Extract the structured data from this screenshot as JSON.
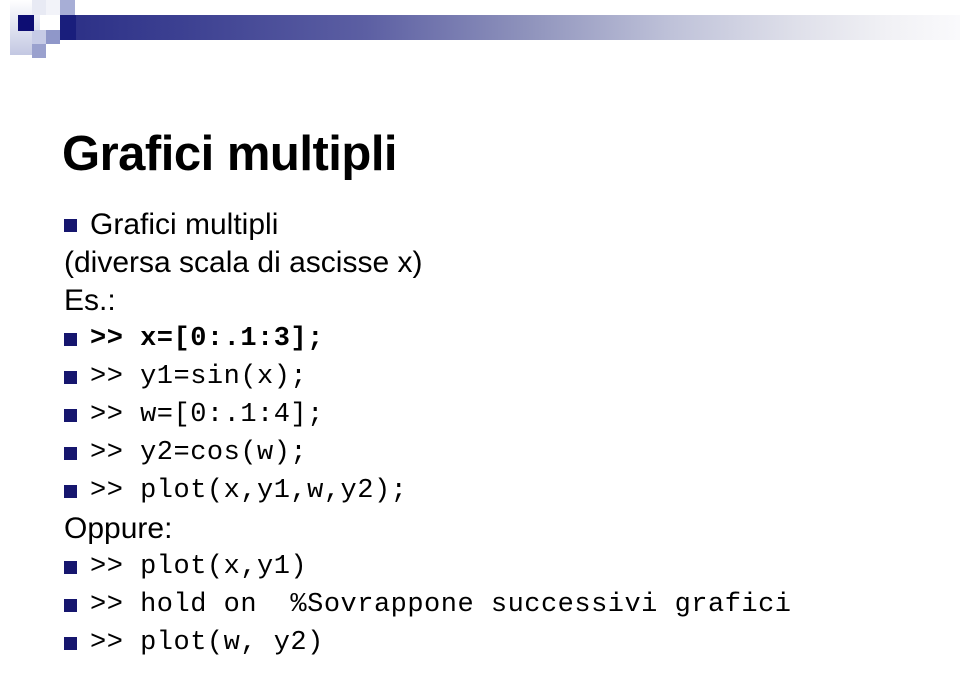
{
  "slide": {
    "title": "Grafici multipli",
    "theme": {
      "bullet_color": "#16166e",
      "accent_dark": "#191e7c",
      "accent_mid": "#8f93bc",
      "accent_light": "#c6cbe6",
      "text_color": "#000000",
      "background": "#ffffff"
    },
    "header": {
      "decoration_name": "checkered-squares-and-gradient-bar"
    },
    "body": {
      "lines": [
        {
          "bullet": true,
          "style": "sans",
          "bold": false,
          "text": "Grafici multipli"
        },
        {
          "bullet": false,
          "style": "sans",
          "bold": false,
          "text": "(diversa scala di ascisse x)"
        },
        {
          "bullet": false,
          "style": "sans",
          "bold": false,
          "text": "Es.:"
        },
        {
          "bullet": true,
          "style": "mono",
          "bold": true,
          "text": ">> x=[0:.1:3];"
        },
        {
          "bullet": true,
          "style": "mono",
          "bold": false,
          "text": ">> y1=sin(x);"
        },
        {
          "bullet": true,
          "style": "mono",
          "bold": false,
          "text": ">> w=[0:.1:4];"
        },
        {
          "bullet": true,
          "style": "mono",
          "bold": false,
          "text": ">> y2=cos(w);"
        },
        {
          "bullet": true,
          "style": "mono",
          "bold": false,
          "text": ">> plot(x,y1,w,y2);"
        },
        {
          "bullet": false,
          "style": "sans",
          "bold": false,
          "text": "Oppure:"
        },
        {
          "bullet": true,
          "style": "mono",
          "bold": false,
          "text": ">> plot(x,y1)"
        },
        {
          "bullet": true,
          "style": "mono",
          "bold": false,
          "text": ">> hold on  %Sovrappone successivi grafici"
        },
        {
          "bullet": true,
          "style": "mono",
          "bold": false,
          "text": ">> plot(w, y2)"
        }
      ]
    }
  }
}
